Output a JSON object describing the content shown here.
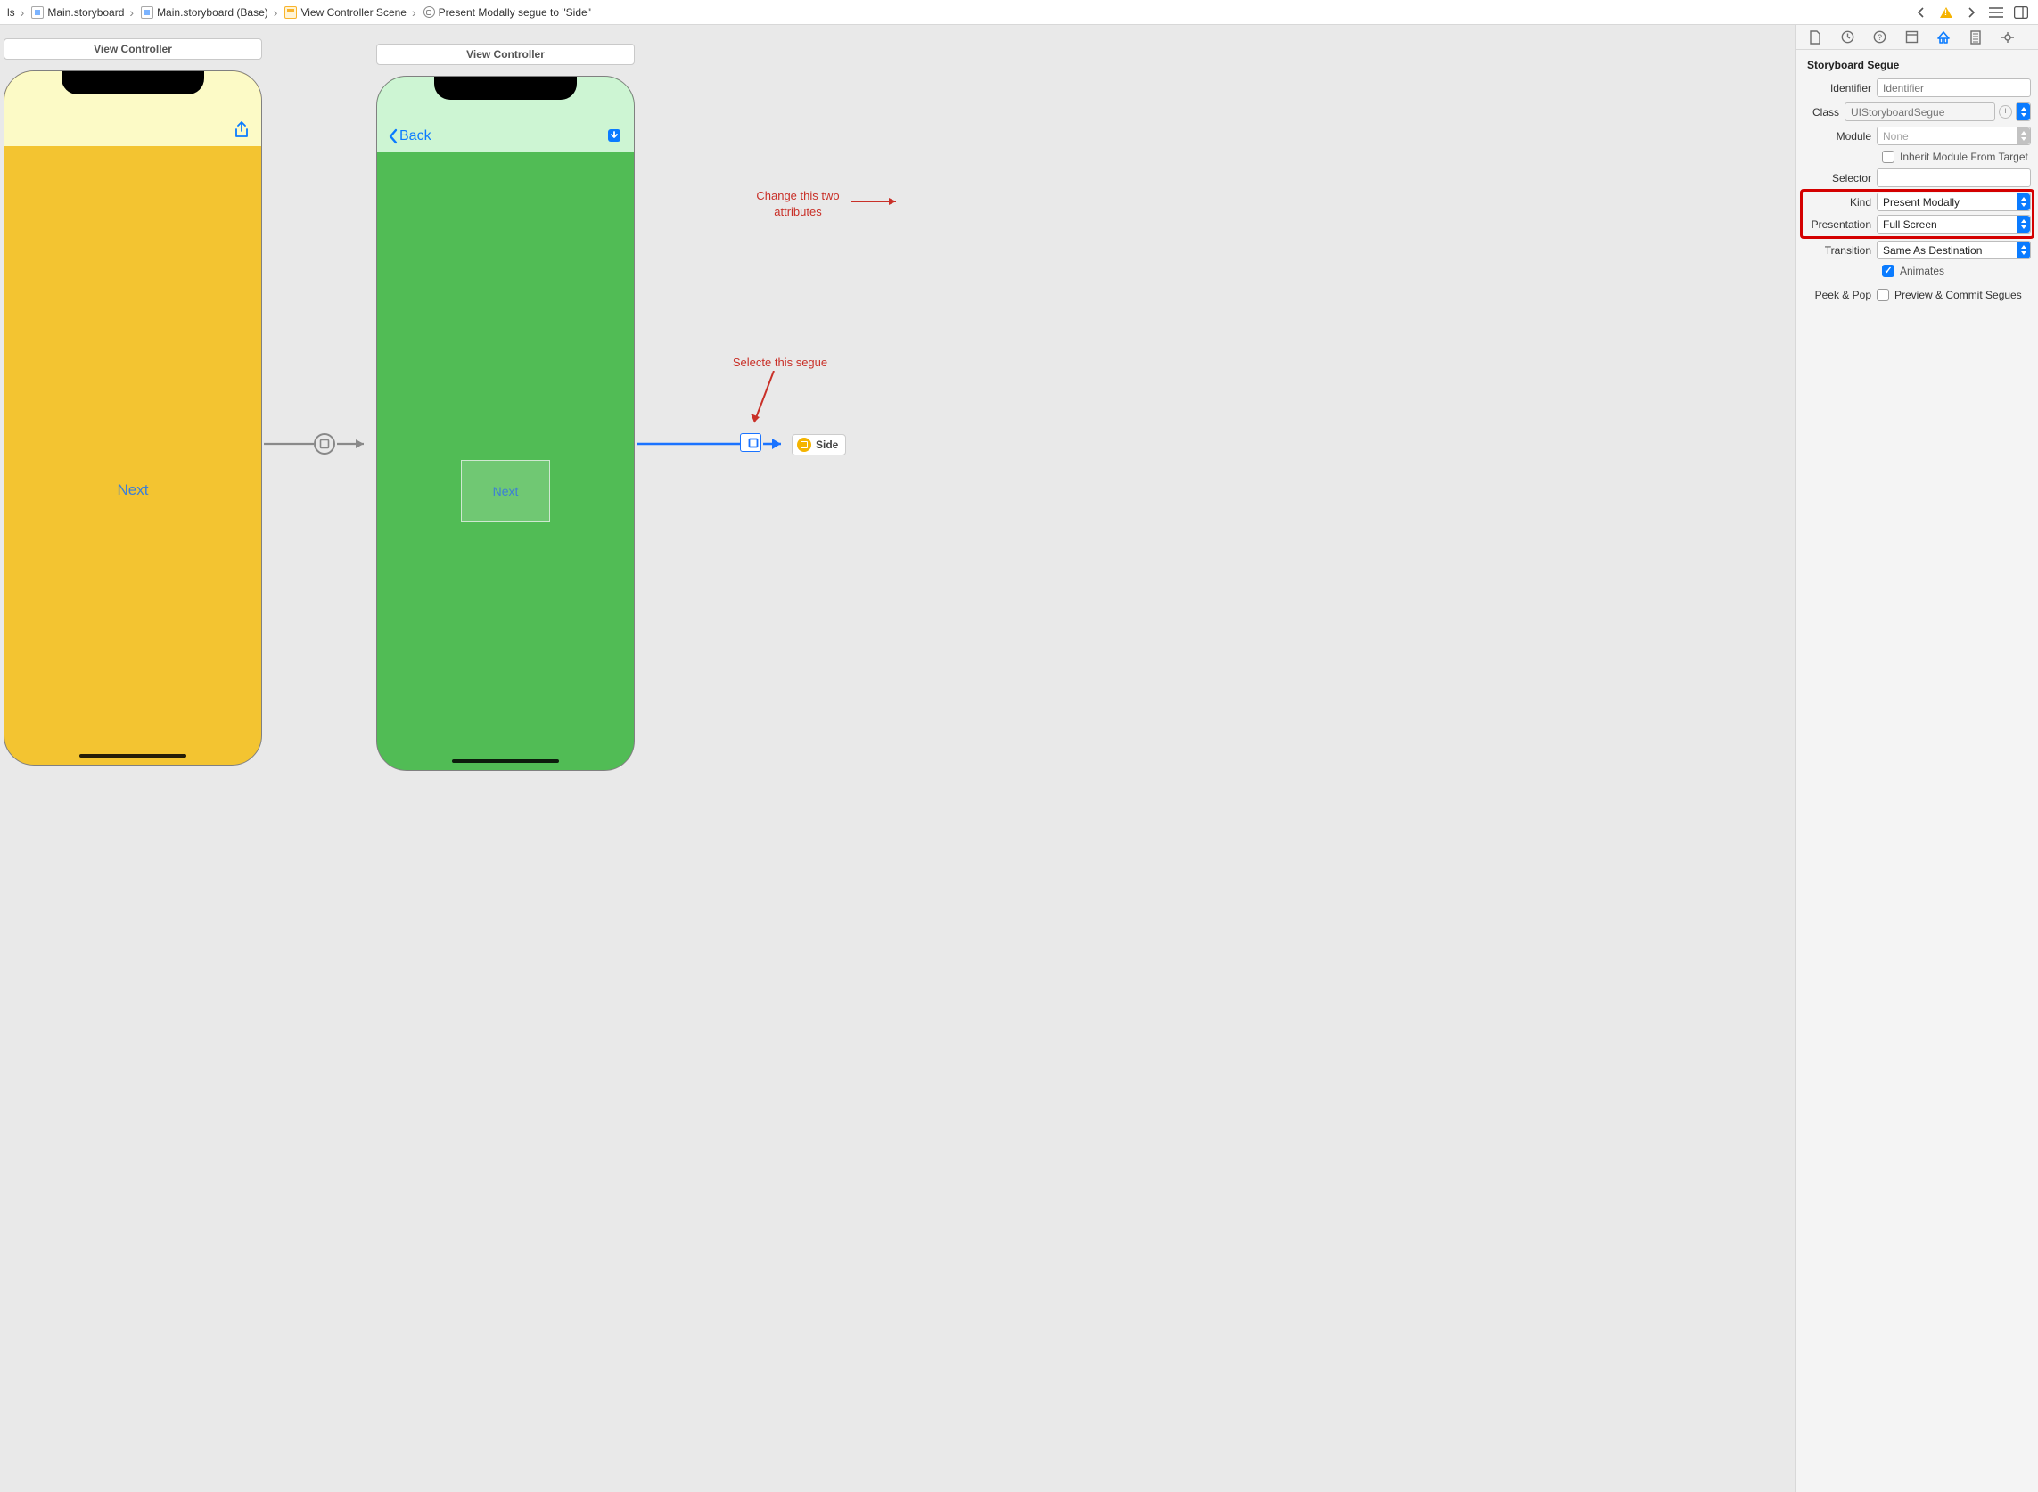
{
  "toolbar": {
    "crumbs": [
      "ls",
      "Main.storyboard",
      "Main.storyboard (Base)",
      "View Controller Scene",
      "Present Modally segue to \"Side\""
    ]
  },
  "canvas": {
    "scenes": [
      {
        "title": "View Controller",
        "back_label": "",
        "button_label": "Next"
      },
      {
        "title": "View Controller",
        "back_label": "Back",
        "button_label": "Next"
      }
    ],
    "side_ref_label": "Side"
  },
  "annotations": {
    "attrs": "Change this two\nattributes",
    "segue": "Selecte this segue"
  },
  "inspector": {
    "section": "Storyboard Segue",
    "identifier": {
      "label": "Identifier",
      "placeholder": "Identifier",
      "value": ""
    },
    "klass": {
      "label": "Class",
      "placeholder": "UIStoryboardSegue",
      "value": ""
    },
    "module": {
      "label": "Module",
      "value": "None"
    },
    "inherit": {
      "label": "Inherit Module From Target",
      "checked": false
    },
    "selector": {
      "label": "Selector",
      "value": ""
    },
    "kind": {
      "label": "Kind",
      "value": "Present Modally"
    },
    "presentation": {
      "label": "Presentation",
      "value": "Full Screen"
    },
    "transition": {
      "label": "Transition",
      "value": "Same As Destination"
    },
    "animates": {
      "label": "Animates",
      "checked": true
    },
    "peekpop": {
      "label": "Peek & Pop",
      "option": "Preview & Commit Segues",
      "checked": false
    }
  }
}
